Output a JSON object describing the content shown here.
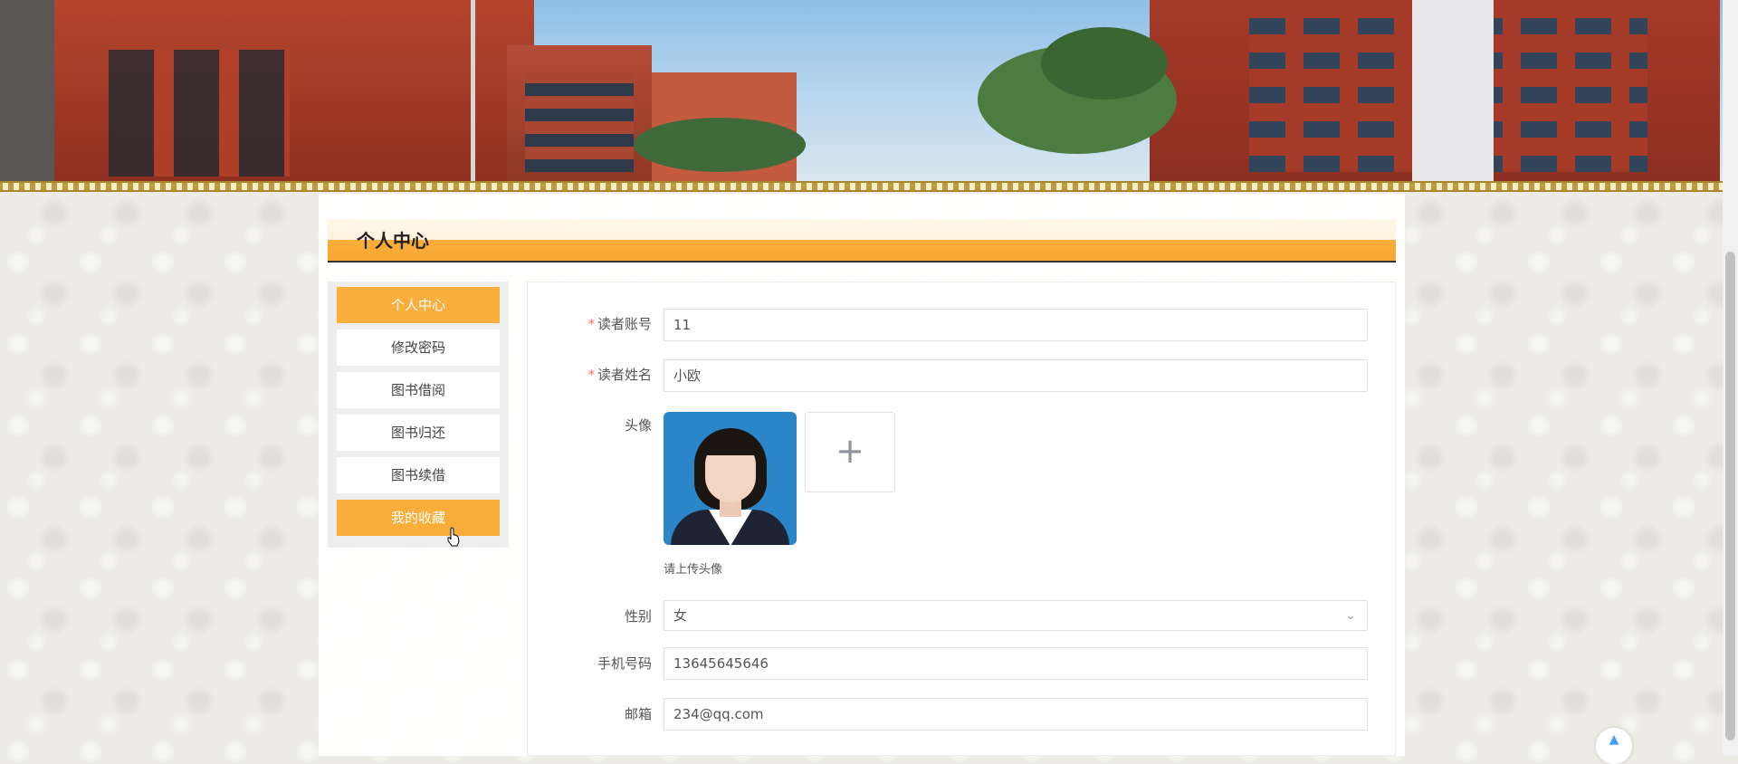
{
  "page": {
    "section_title": "个人中心"
  },
  "sidebar": {
    "items": [
      {
        "label": "个人中心",
        "active": true
      },
      {
        "label": "修改密码",
        "active": false
      },
      {
        "label": "图书借阅",
        "active": false
      },
      {
        "label": "图书归还",
        "active": false
      },
      {
        "label": "图书续借",
        "active": false
      },
      {
        "label": "我的收藏",
        "active": true
      }
    ]
  },
  "form": {
    "account": {
      "label": "读者账号",
      "required": true,
      "value": "11"
    },
    "name": {
      "label": "读者姓名",
      "required": true,
      "value": "小欧"
    },
    "avatar": {
      "label": "头像",
      "hint": "请上传头像",
      "upload_icon": "plus-icon"
    },
    "gender": {
      "label": "性别",
      "value": "女",
      "icon": "chevron-down-icon"
    },
    "phone": {
      "label": "手机号码",
      "value": "13645645646"
    },
    "email": {
      "label": "邮箱",
      "value": "234@qq.com"
    }
  },
  "colors": {
    "accent": "#f9ae3c",
    "required": "#f56c6c",
    "back_to_top": "#409eff"
  },
  "icons": {
    "back_to_top": "caret-up-icon",
    "required_mark": "*"
  }
}
